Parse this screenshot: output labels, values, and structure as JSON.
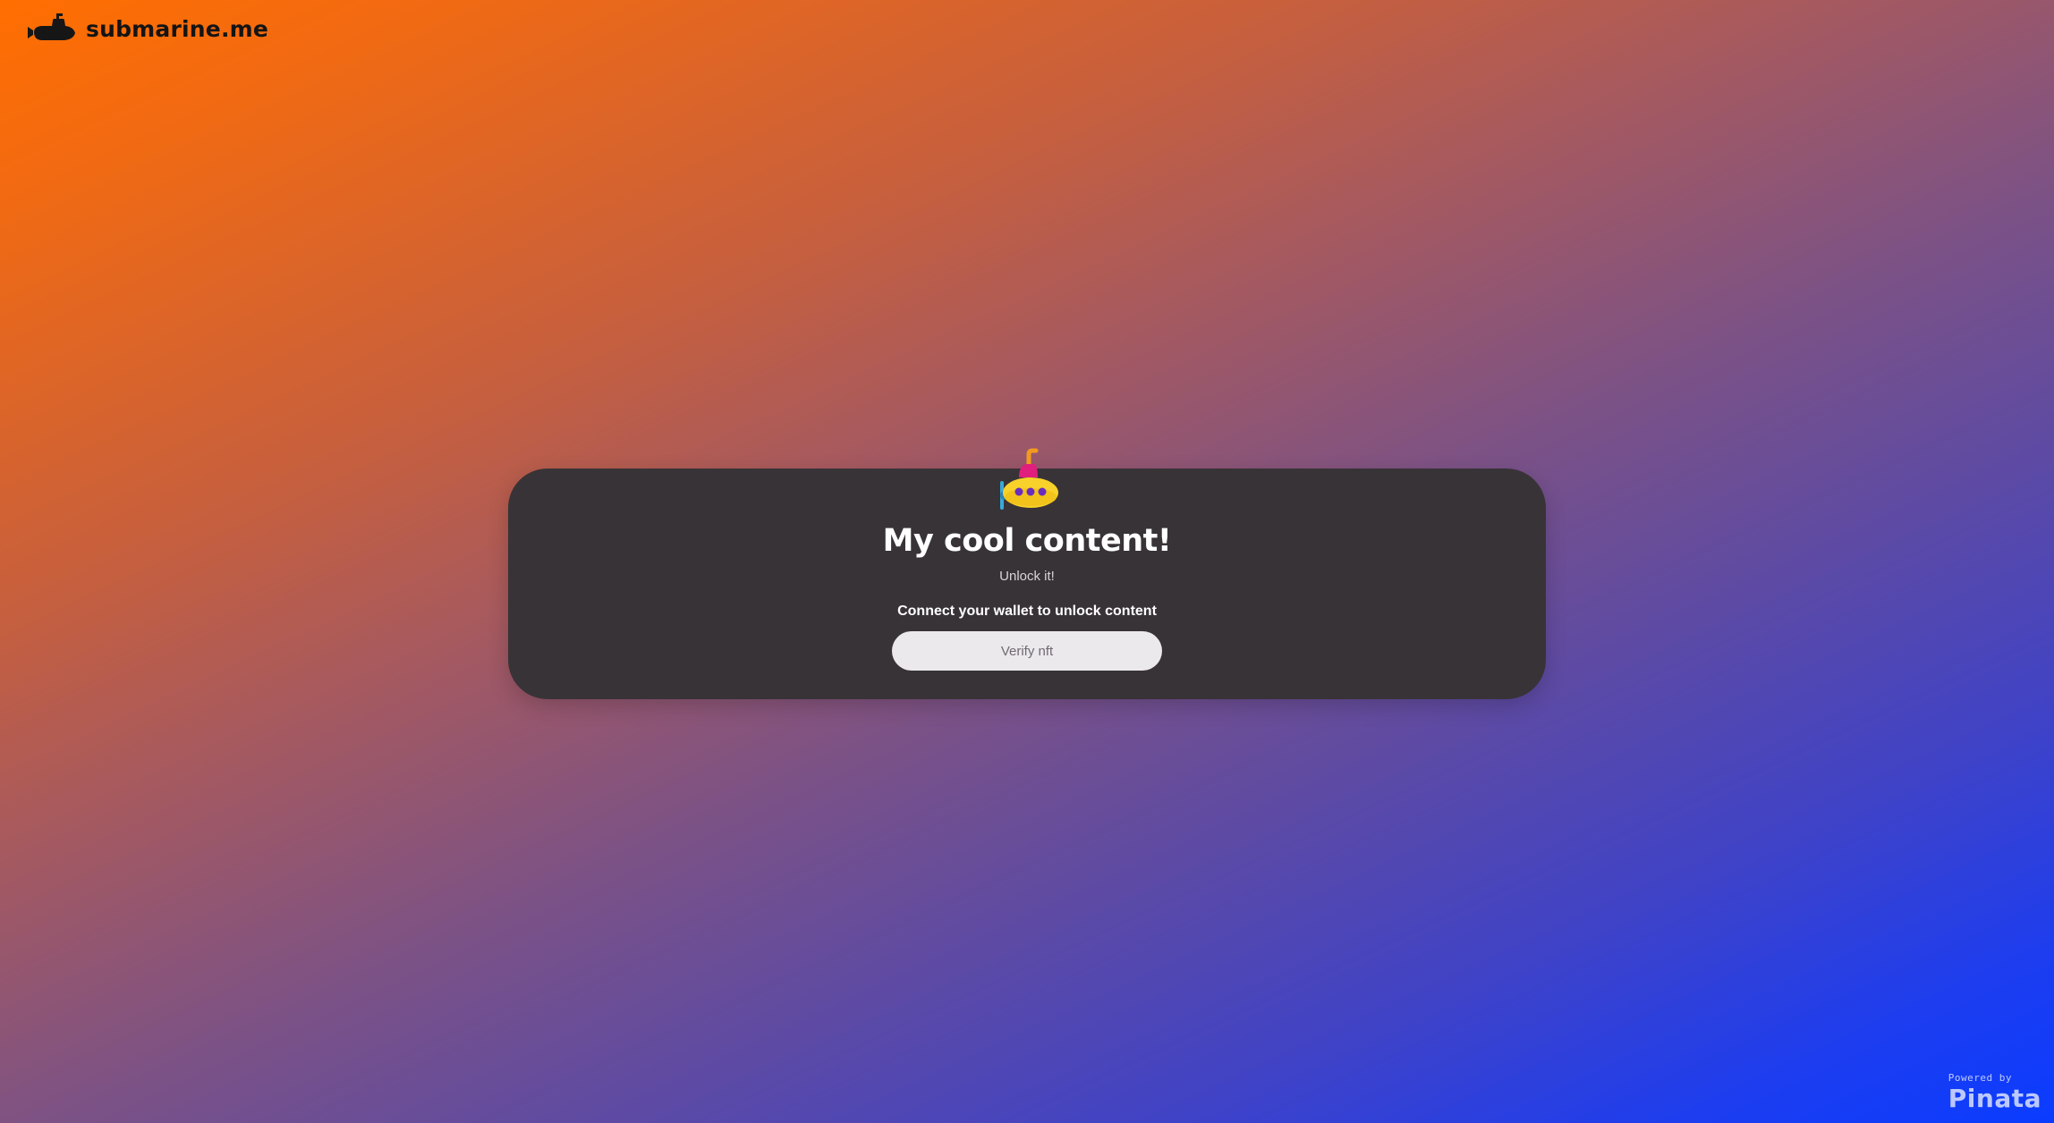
{
  "header": {
    "brand_name": "submarine.me",
    "logo_icon": "submarine-icon"
  },
  "card": {
    "icon": "yellow-submarine-icon",
    "title": "My cool content!",
    "subtitle": "Unlock it!",
    "prompt": "Connect your wallet to unlock content",
    "button_label": "Verify nft"
  },
  "footer": {
    "powered_label": "Powered by",
    "powered_name": "Pinata"
  },
  "colors": {
    "gradient_start": "#ff6e00",
    "gradient_end": "#0a3cff",
    "card_background": "#383337",
    "button_background": "#ebe9ec"
  }
}
